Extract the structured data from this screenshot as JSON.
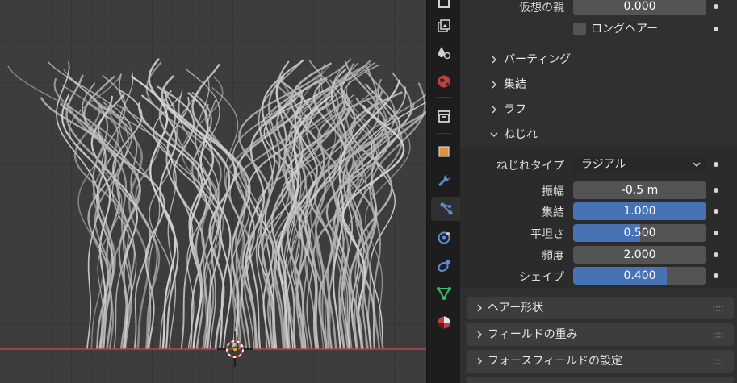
{
  "panel": {
    "virtual_parent": {
      "label": "仮想の親",
      "value": "0.000"
    },
    "long_hair": {
      "label": "ロングヘアー",
      "checked": false
    },
    "subpanels": [
      {
        "label": "パーティング",
        "expanded": false
      },
      {
        "label": "集結",
        "expanded": false
      },
      {
        "label": "ラフ",
        "expanded": false
      },
      {
        "label": "ねじれ",
        "expanded": true
      }
    ],
    "twist": {
      "type_label": "ねじれタイプ",
      "type_value": "ラジアル",
      "fields": [
        {
          "label": "振幅",
          "value": "-0.5 m",
          "fill": 0
        },
        {
          "label": "集結",
          "value": "1.000",
          "fill": 1.0
        },
        {
          "label": "平坦さ",
          "value": "0.500",
          "fill": 0.5
        },
        {
          "label": "頻度",
          "value": "2.000",
          "fill": 0
        },
        {
          "label": "シェイプ",
          "value": "0.400",
          "fill": 0.7
        }
      ]
    },
    "sections": [
      {
        "label": "ヘアー形状"
      },
      {
        "label": "フィールドの重み"
      },
      {
        "label": "フォースフィールドの設定"
      }
    ]
  },
  "tabs": [
    "render-icon",
    "image-icon",
    "physics-drops-icon",
    "world-icon",
    "collection-box-icon",
    "object-icon",
    "modifier-wrench-icon",
    "particles-icon",
    "physics-icon",
    "constraints-icon",
    "object-data-icon",
    "material-icon"
  ],
  "colors": {
    "accent": "#4772b3",
    "field": "#545454",
    "panel": "#303030",
    "tab_bar": "#1d1d1d",
    "viewport": "#3d3d3d",
    "hair": "#c8c8c8",
    "x_axis": "#b34848",
    "origin": "#e0a030"
  }
}
